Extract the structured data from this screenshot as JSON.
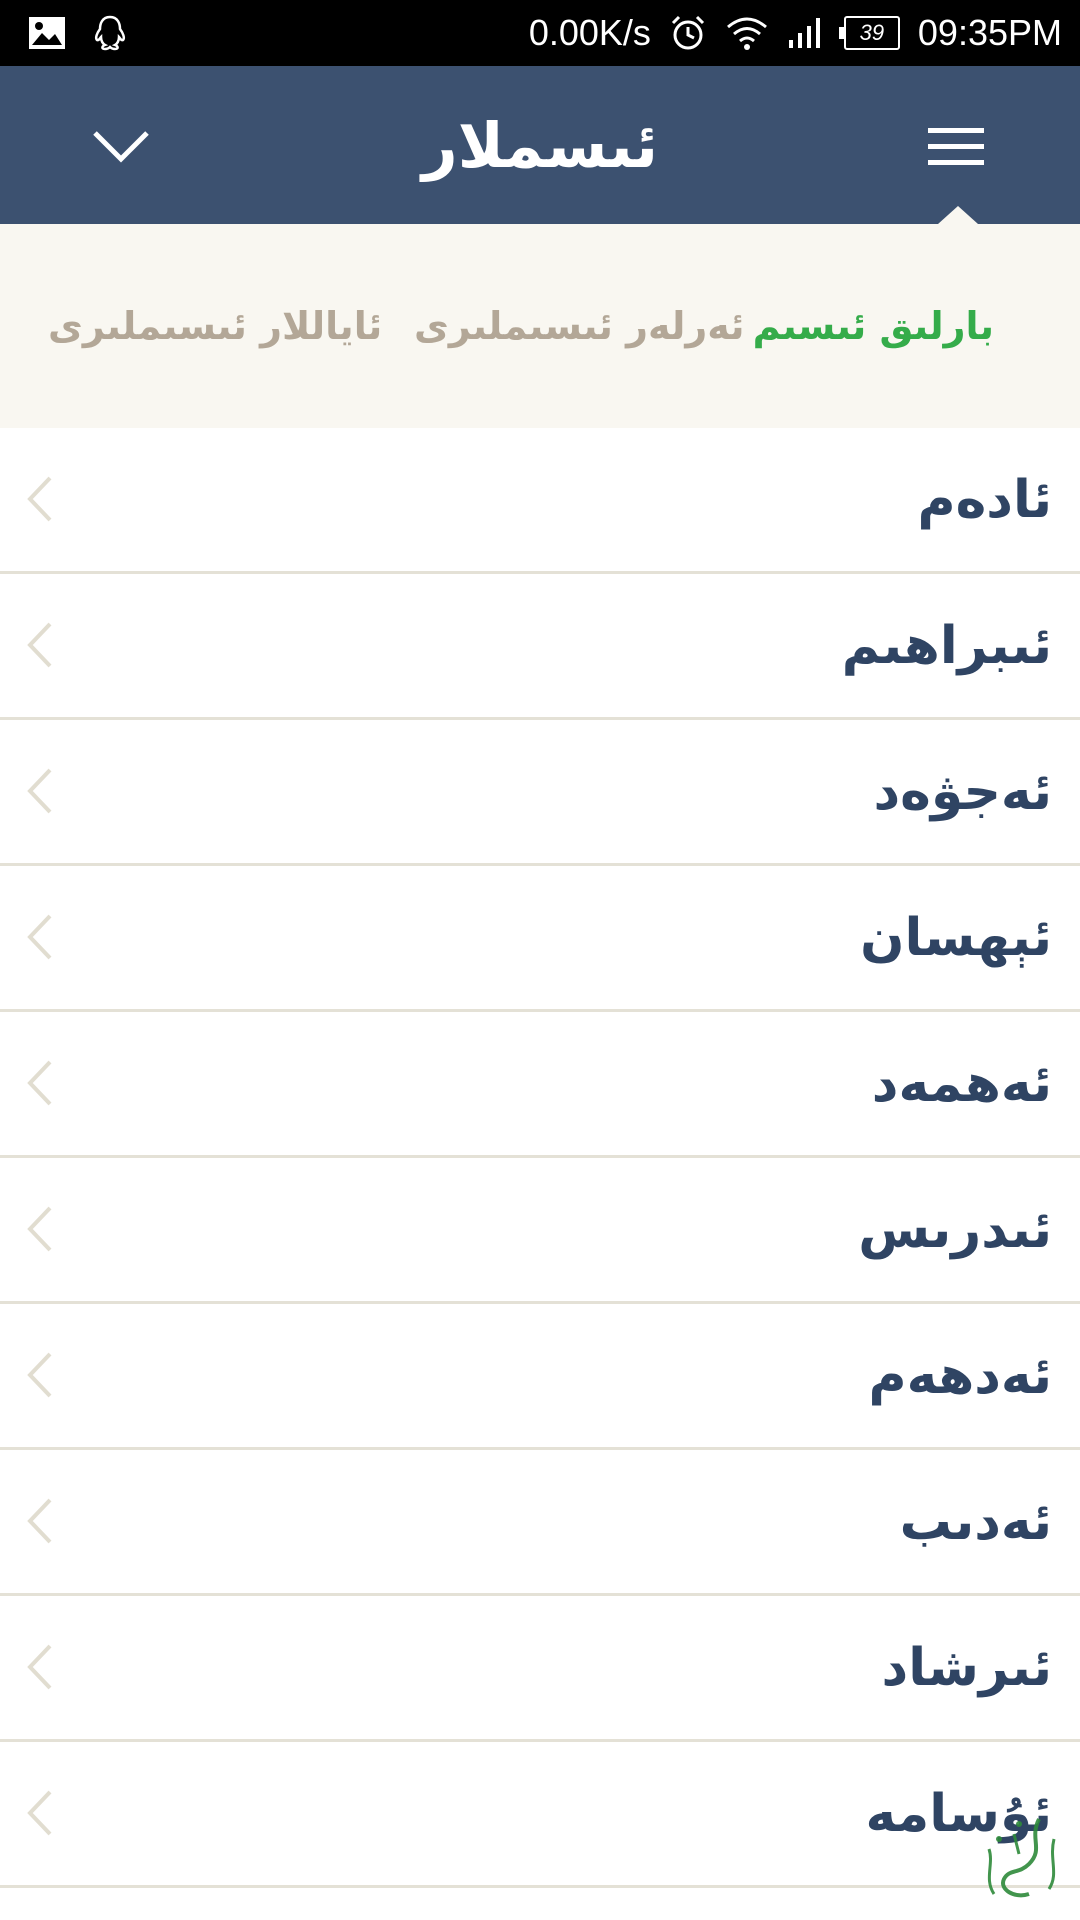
{
  "status_bar": {
    "net_speed": "0.00K/s",
    "battery": "39",
    "time": "09:35PM",
    "icons": [
      "image-icon",
      "qq-icon",
      "alarm-icon",
      "wifi-icon",
      "signal-icon",
      "battery-icon"
    ]
  },
  "app_bar": {
    "title": "ئىسملار",
    "left_icon": "chevron-down-icon",
    "right_icon": "menu-icon"
  },
  "tabs": [
    {
      "label": "بارلىق ئىسىم",
      "selected": true
    },
    {
      "label": "ئەرلەر ئىسىملىرى",
      "selected": false
    },
    {
      "label": "ئاياللار ئىسىملىرى",
      "selected": false
    }
  ],
  "names": [
    {
      "label": "ئادەم"
    },
    {
      "label": "ئىبراھىم"
    },
    {
      "label": "ئەجۋەد"
    },
    {
      "label": "ئېھسان"
    },
    {
      "label": "ئەھمەد"
    },
    {
      "label": "ئىدرىس"
    },
    {
      "label": "ئەدھەم"
    },
    {
      "label": "ئەدىب"
    },
    {
      "label": "ئىرشاد"
    },
    {
      "label": "ئۇسامە"
    }
  ],
  "colors": {
    "app_bar": "#3c5170",
    "tab_bg": "#f9f7f1",
    "tab_active": "#35ac4a",
    "tab_inactive": "#b3a797",
    "name_text": "#2f4463",
    "divider": "#e4e1d6"
  }
}
